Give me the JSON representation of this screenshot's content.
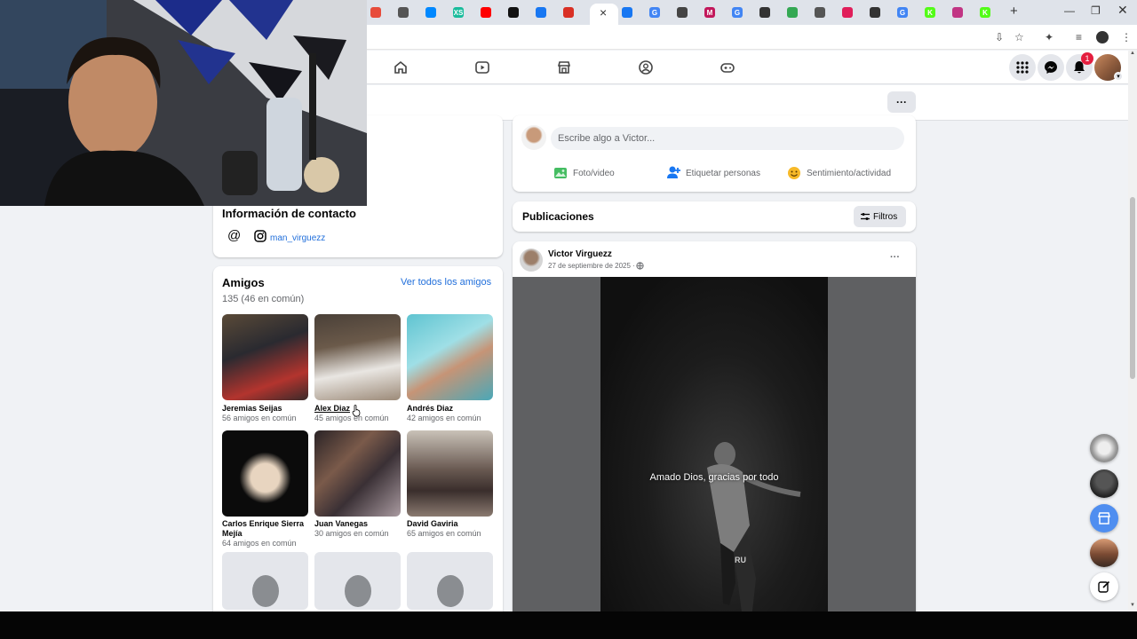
{
  "browser": {
    "tabs": [
      {
        "icon": "chrome-icon",
        "color": "#e74c3c",
        "label": ""
      },
      {
        "icon": "chatgpt-icon",
        "color": "#555555",
        "label": ""
      },
      {
        "icon": "shazam-icon",
        "color": "#0088ff",
        "label": ""
      },
      {
        "icon": "app-icon",
        "color": "#1abc9c",
        "label": "XS"
      },
      {
        "icon": "youtube-icon",
        "color": "#ff0000",
        "label": ""
      },
      {
        "icon": "tiktok-icon",
        "color": "#111111",
        "label": ""
      },
      {
        "icon": "facebook-icon",
        "color": "#1877f2",
        "label": ""
      },
      {
        "icon": "gmail-icon",
        "color": "#d93025",
        "label": ""
      }
    ],
    "tabs_after": [
      {
        "icon": "facebook-icon",
        "color": "#1877f2",
        "label": ""
      },
      {
        "icon": "google-icon",
        "color": "#4285f4",
        "label": "G"
      },
      {
        "icon": "app-icon",
        "color": "#444444",
        "label": ""
      },
      {
        "icon": "mega-icon",
        "color": "#c2185b",
        "label": "M"
      },
      {
        "icon": "google-icon",
        "color": "#4285f4",
        "label": "G"
      },
      {
        "icon": "app-icon",
        "color": "#333333",
        "label": ""
      },
      {
        "icon": "maps-icon",
        "color": "#34a853",
        "label": ""
      },
      {
        "icon": "chatgpt-icon",
        "color": "#555555",
        "label": ""
      },
      {
        "icon": "slack-icon",
        "color": "#e01e5a",
        "label": ""
      },
      {
        "icon": "app-icon",
        "color": "#333333",
        "label": ""
      },
      {
        "icon": "google-icon",
        "color": "#4285f4",
        "label": "G"
      },
      {
        "icon": "kick-icon",
        "color": "#53fc18",
        "label": "K"
      },
      {
        "icon": "instagram-icon",
        "color": "#c13584",
        "label": ""
      },
      {
        "icon": "kick-icon",
        "color": "#53fc18",
        "label": "K"
      }
    ],
    "new_tab": "+",
    "active_tab_close": "×"
  },
  "header": {
    "notification_count": "1",
    "more": "···"
  },
  "composer": {
    "placeholder": "Escribe algo a Victor...",
    "photo": "Foto/video",
    "tag": "Etiquetar personas",
    "feeling": "Sentimiento/actividad"
  },
  "contact": {
    "title": "Información de contacto",
    "instagram": "man_virguezz"
  },
  "friends": {
    "title": "Amigos",
    "count": "135 (46 en común)",
    "see_all": "Ver todos los amigos",
    "items": [
      {
        "name": "Jeremias Seijas",
        "mutual": "56 amigos en común"
      },
      {
        "name": "Alex Diaz",
        "mutual": "45 amigos en común"
      },
      {
        "name": "Andrés Diaz",
        "mutual": "42 amigos en común"
      },
      {
        "name": "Carlos Enrique Sierra Mejía",
        "mutual": "64 amigos en común"
      },
      {
        "name": "Juan Vanegas",
        "mutual": "30 amigos en común"
      },
      {
        "name": "David Gaviria",
        "mutual": "65 amigos en común"
      }
    ]
  },
  "posts": {
    "title": "Publicaciones",
    "filter": "Filtros"
  },
  "post": {
    "author": "Victor Virguezz",
    "date": "27 de septiembre de 2025 · ",
    "more": "···",
    "caption": "Amado Dios, gracias por todo"
  }
}
